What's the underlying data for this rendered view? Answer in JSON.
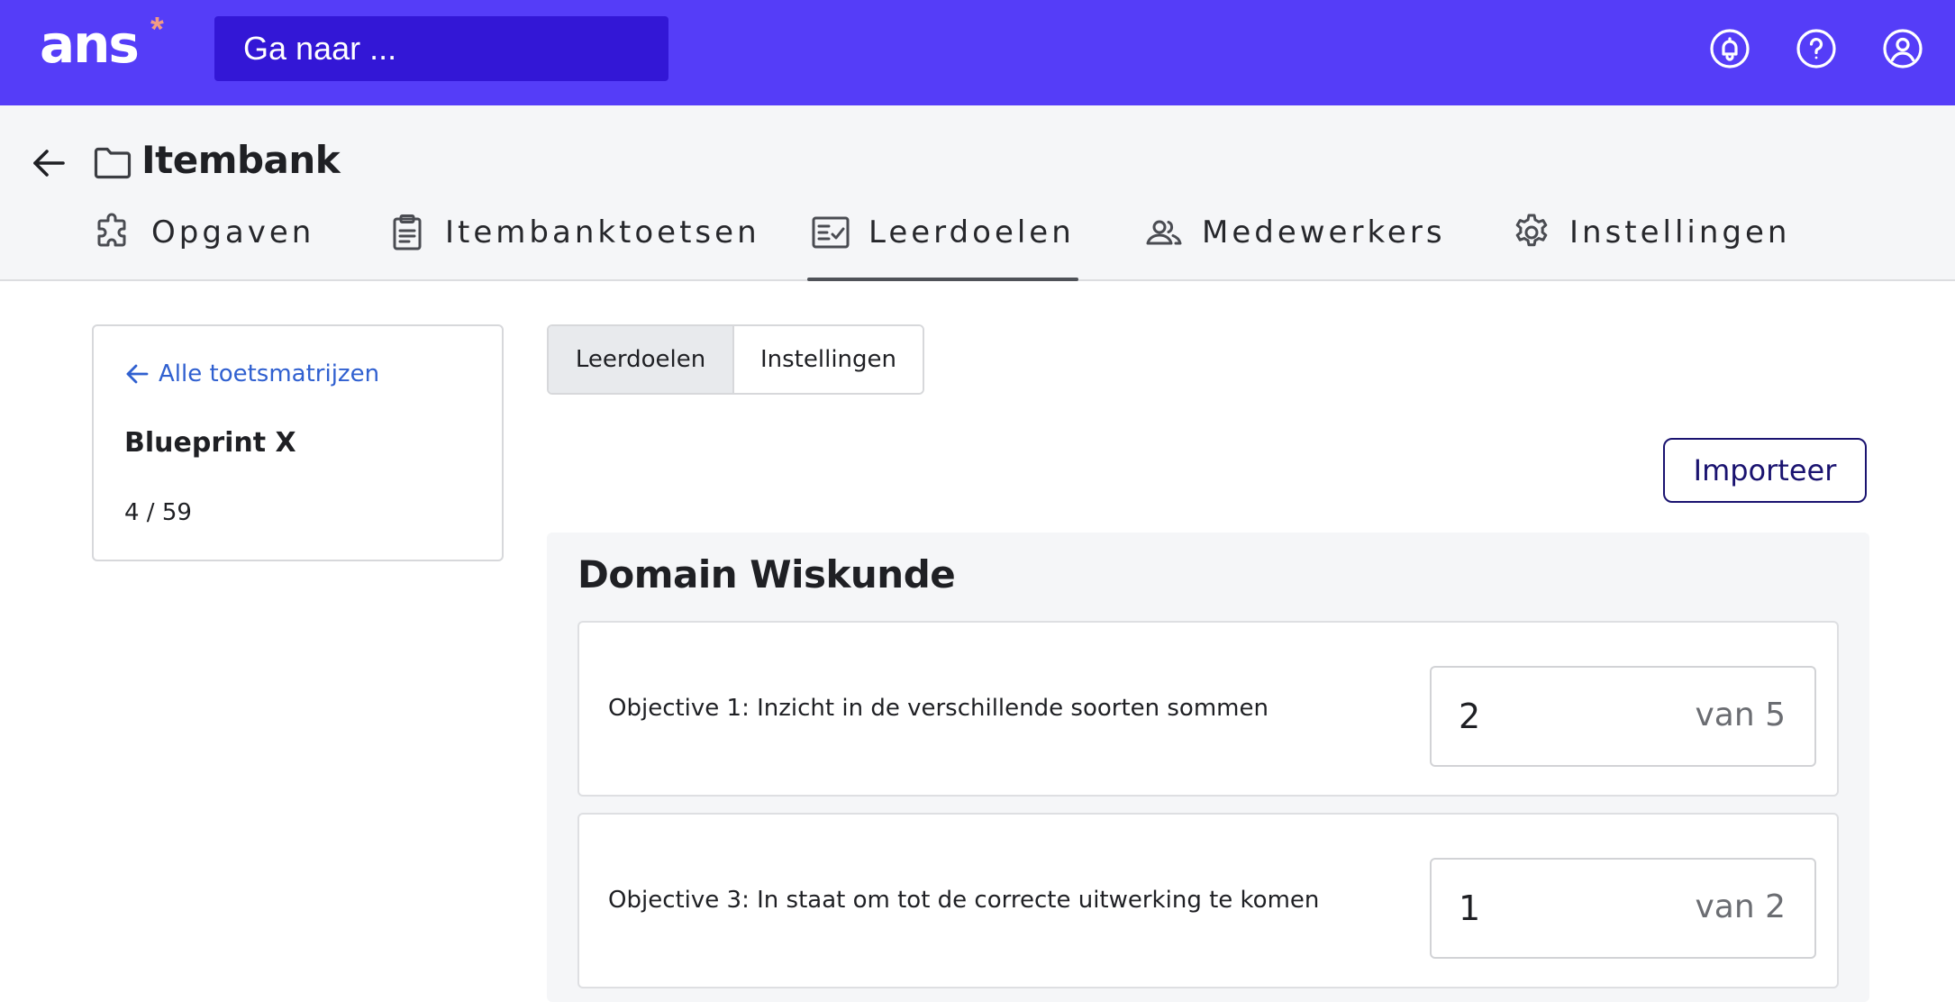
{
  "topbar": {
    "logo": "ans",
    "logo_mark": "*",
    "search_placeholder": "Ga naar ...",
    "icons": [
      "bell-icon",
      "help-icon",
      "user-icon"
    ],
    "background": "#553df8",
    "search_background": "#3317d6",
    "logo_mark_color": "#f29b84"
  },
  "header": {
    "title": "Itembank",
    "tabs": [
      {
        "label": "Opgaven",
        "icon": "puzzle-icon",
        "active": false
      },
      {
        "label": "Itembanktoetsen",
        "icon": "clipboard-icon",
        "active": false
      },
      {
        "label": "Leerdoelen",
        "icon": "checklist-icon",
        "active": true
      },
      {
        "label": "Medewerkers",
        "icon": "users-icon",
        "active": false
      },
      {
        "label": "Instellingen",
        "icon": "gear-icon",
        "active": false
      }
    ]
  },
  "sidebar": {
    "back_link": "Alle toetsmatrijzen",
    "title": "Blueprint X",
    "count": "4 / 59",
    "link_color": "#3060d0"
  },
  "segmented": {
    "options": [
      "Leerdoelen",
      "Instellingen"
    ],
    "selected": "Leerdoelen"
  },
  "actions": {
    "import_label": "Importeer"
  },
  "domain": {
    "title": "Domain Wiskunde",
    "objectives": [
      {
        "text": "Objective 1: Inzicht in de verschillende soorten sommen",
        "value": "2",
        "total": "van 5"
      },
      {
        "text": "Objective 3: In staat om tot de correcte uitwerking te komen",
        "value": "1",
        "total": "van 2"
      }
    ]
  }
}
